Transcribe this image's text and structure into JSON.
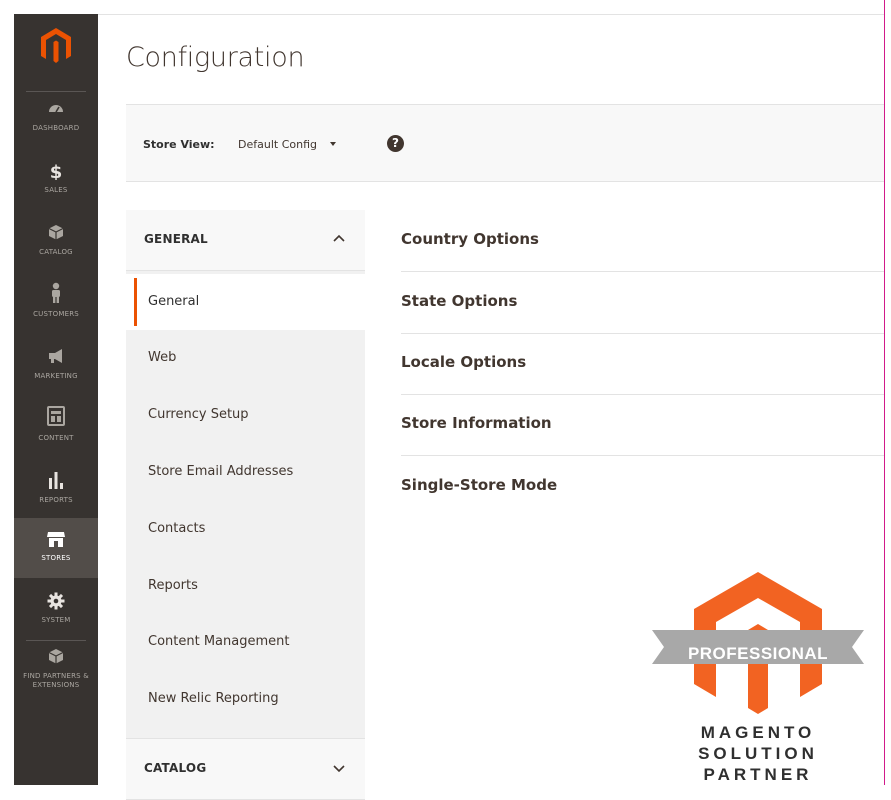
{
  "sidebar": {
    "items": [
      {
        "label": "DASHBOARD",
        "icon": "dashboard-icon"
      },
      {
        "label": "SALES",
        "icon": "dollar-icon"
      },
      {
        "label": "CATALOG",
        "icon": "box-icon"
      },
      {
        "label": "CUSTOMERS",
        "icon": "person-icon"
      },
      {
        "label": "MARKETING",
        "icon": "megaphone-icon"
      },
      {
        "label": "CONTENT",
        "icon": "layout-icon"
      },
      {
        "label": "REPORTS",
        "icon": "bar-chart-icon"
      },
      {
        "label": "STORES",
        "icon": "storefront-icon"
      },
      {
        "label": "SYSTEM",
        "icon": "gear-icon"
      },
      {
        "label": "FIND PARTNERS & EXTENSIONS",
        "icon": "cube-icon"
      }
    ],
    "active": "STORES"
  },
  "page": {
    "title": "Configuration"
  },
  "store_switcher": {
    "label": "Store View:",
    "value": "Default Config"
  },
  "tabs": {
    "general_title": "GENERAL",
    "general_items": [
      "General",
      "Web",
      "Currency Setup",
      "Store Email Addresses",
      "Contacts",
      "Reports",
      "Content Management",
      "New Relic Reporting"
    ],
    "active_item": "General",
    "catalog_title": "CATALOG"
  },
  "sections": [
    "Country Options",
    "State Options",
    "Locale Options",
    "Store Information",
    "Single-Store Mode"
  ],
  "badge": {
    "ribbon": "PROFESSIONAL",
    "line1": "MAGENTO",
    "line2": "SOLUTION",
    "line3": "PARTNER"
  },
  "colors": {
    "sidebar_bg": "#373330",
    "accent": "#eb5202",
    "badge_orange": "#f26322",
    "ribbon_gray": "#a8a8a8"
  }
}
